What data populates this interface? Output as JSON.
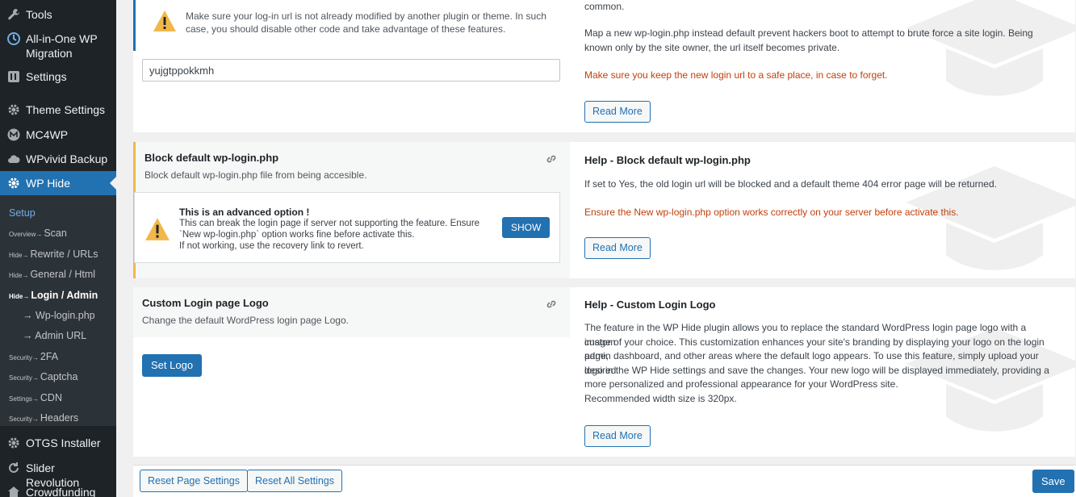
{
  "sidebar": {
    "items_top": [
      {
        "label": "Tools",
        "icon": "wrench-icon"
      },
      {
        "label": "All-in-One WP Migration",
        "icon": "migration-icon"
      },
      {
        "label": "Settings",
        "icon": "settings-icon"
      },
      {
        "label": "Theme Settings",
        "icon": "gear-icon"
      },
      {
        "label": "MC4WP",
        "icon": "mc4wp-icon"
      },
      {
        "label": "WPvivid Backup",
        "icon": "cloud-icon"
      },
      {
        "label": "WP Hide",
        "icon": "gear-icon"
      }
    ],
    "submenu": [
      {
        "prefix": "",
        "label": "Setup"
      },
      {
        "prefix": "Overview→",
        "label": "Scan"
      },
      {
        "prefix": "Hide→",
        "label": "Rewrite / URLs"
      },
      {
        "prefix": "Hide→",
        "label": "General / Html"
      },
      {
        "prefix": "Hide→",
        "label": "Login / Admin"
      },
      {
        "prefix": "",
        "label": "→ Wp-login.php"
      },
      {
        "prefix": "",
        "label": "→ Admin URL"
      },
      {
        "prefix": "Security→",
        "label": "2FA"
      },
      {
        "prefix": "Security→",
        "label": "Captcha"
      },
      {
        "prefix": "Settings→",
        "label": "CDN"
      },
      {
        "prefix": "Security→",
        "label": "Headers"
      }
    ],
    "items_bottom": [
      {
        "label": "OTGS Installer",
        "icon": "gear-icon"
      },
      {
        "label": "Slider Revolution",
        "icon": "refresh-icon"
      },
      {
        "label": "Crowdfunding",
        "icon": "home-icon"
      }
    ]
  },
  "section1": {
    "warning": "Make sure your log-in url is not already modified by another plugin or theme. In such case, you should disable other code and take advantage of these features.",
    "input_value": "yujgtppokkmh",
    "help_line0": "common.",
    "help_text": "Map a new wp-login.php instead default prevent hackers boot to attempt to brute force a site login. Being known only by the site owner, the url itself becomes private.",
    "help_warn": "Make sure you keep the new login url to a safe place, in case to forget.",
    "read_more": "Read More"
  },
  "section2": {
    "title": "Block default wp-login.php",
    "desc": "Block default wp-login.php file from being accesible.",
    "adv_title": "This is an advanced option !",
    "adv_line1": "This can break the login page if server not supporting the feature. Ensure",
    "adv_line2": "`New wp-login.php` option works fine before activate this.",
    "adv_line3": "If not working, use the recovery link to revert.",
    "show_label": "SHOW",
    "help_title": "Help - Block default wp-login.php",
    "help_text": "If set to Yes, the old login url will be blocked and a default theme 404 error page will be returned.",
    "help_warn": "Ensure the New wp-login.php option works correctly on your server before activate this.",
    "read_more": "Read More"
  },
  "section3": {
    "title": "Custom Login page Logo",
    "desc": "Change the default WordPress login page Logo.",
    "set_logo": "Set Logo",
    "help_title": "Help - Custom Login Logo",
    "help_lines": [
      "The feature in the WP Hide plugin allows you to replace the standard WordPress login page logo with a custom",
      "image of your choice. This customization enhances your site's branding by displaying your logo on the login page,",
      "admin dashboard, and other areas where the default logo appears. To use this feature, simply upload your desired",
      "logo in the WP Hide settings and save the changes. Your new logo will be displayed immediately, providing a",
      "more personalized and professional appearance for your WordPress site.",
      "Recommended width size is 320px."
    ],
    "read_more": "Read More"
  },
  "footer": {
    "reset_page": "Reset Page Settings",
    "reset_all": "Reset All Settings",
    "save": "Save"
  },
  "colors": {
    "accent": "#2271b1",
    "warning_border": "#f0b849",
    "warn_text": "#c2410c",
    "sidebar_bg": "#1d2327"
  }
}
